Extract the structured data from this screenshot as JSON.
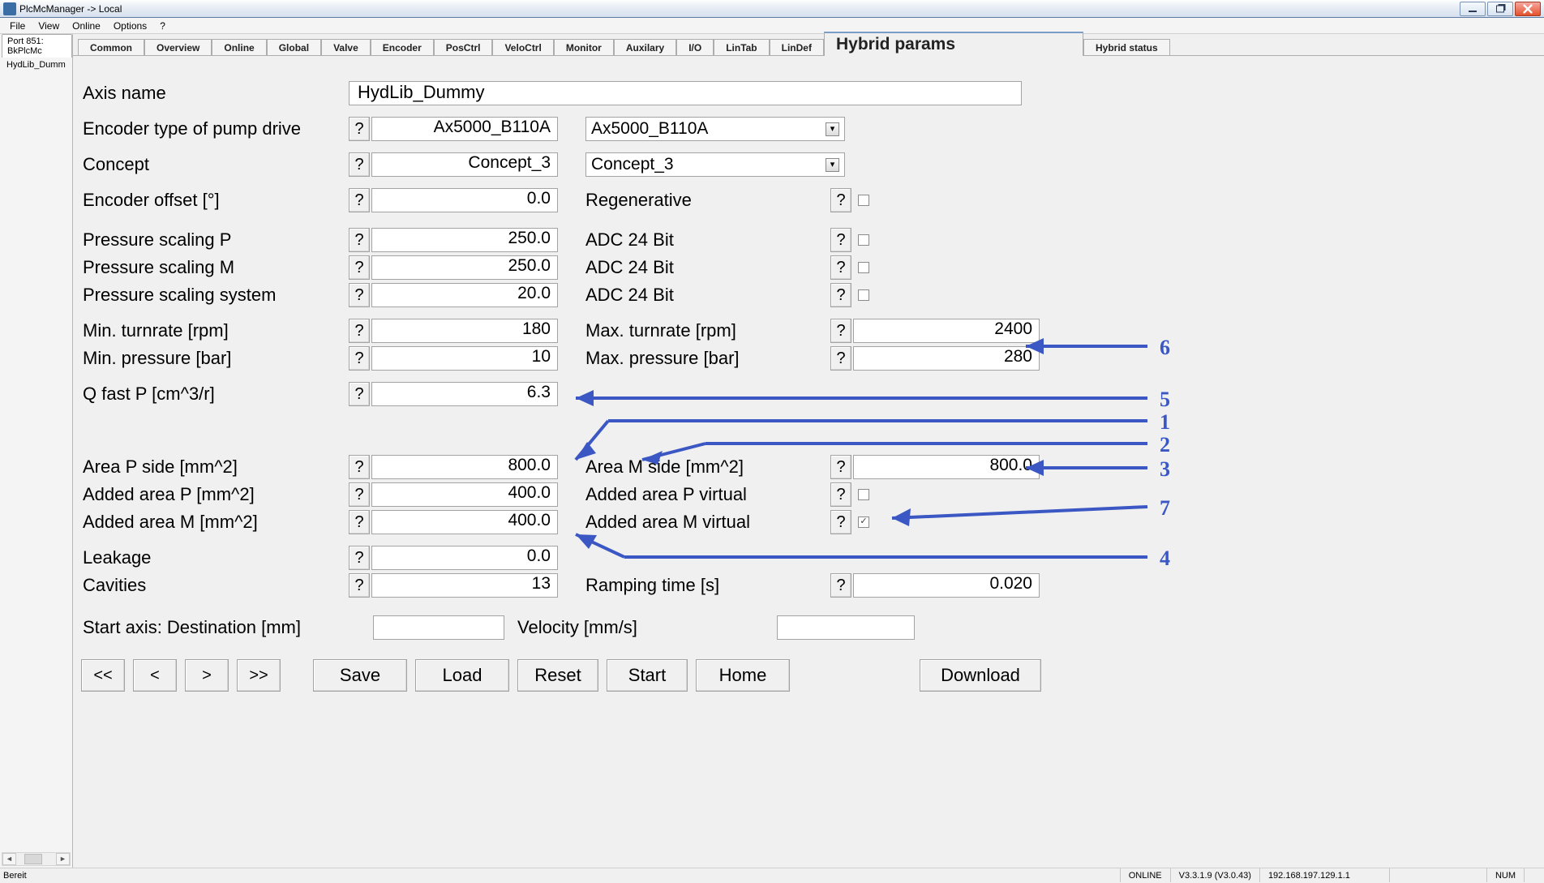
{
  "window": {
    "title": "PlcMcManager -> Local"
  },
  "menu": {
    "items": [
      "File",
      "View",
      "Online",
      "Options",
      "?"
    ]
  },
  "sidebar": {
    "tab": "Port 851: BkPlcMc",
    "item": "HydLib_Dumm"
  },
  "tabs": {
    "items": [
      "Common",
      "Overview",
      "Online",
      "Global",
      "Valve",
      "Encoder",
      "PosCtrl",
      "VeloCtrl",
      "Monitor",
      "Auxilary",
      "I/O",
      "LinTab",
      "LinDef",
      "Hybrid params",
      "Hybrid status"
    ],
    "selected": 13
  },
  "form": {
    "axis_name": {
      "label": "Axis name",
      "value": "HydLib_Dummy"
    },
    "encoder_type": {
      "label": "Encoder type of pump drive",
      "value": "Ax5000_B110A",
      "select": "Ax5000_B110A"
    },
    "concept": {
      "label": "Concept",
      "value": "Concept_3",
      "select": "Concept_3"
    },
    "encoder_offset": {
      "label": "Encoder offset [°]",
      "value": "0.0",
      "rlabel": "Regenerative"
    },
    "ps_p": {
      "label": "Pressure scaling P",
      "value": "250.0",
      "rlabel": "ADC 24 Bit"
    },
    "ps_m": {
      "label": "Pressure scaling M",
      "value": "250.0",
      "rlabel": "ADC 24 Bit"
    },
    "ps_sys": {
      "label": "Pressure scaling system",
      "value": "20.0",
      "rlabel": "ADC 24 Bit"
    },
    "min_turn": {
      "label": "Min. turnrate [rpm]",
      "value": "180"
    },
    "max_turn": {
      "label": "Max. turnrate [rpm]",
      "value": "2400"
    },
    "min_press": {
      "label": "Min. pressure [bar]",
      "value": "10"
    },
    "max_press": {
      "label": "Max. pressure [bar]",
      "value": "280"
    },
    "q_fast": {
      "label": "Q fast P [cm^3/r]",
      "value": "6.3"
    },
    "area_p": {
      "label": "Area P side [mm^2]",
      "value": "800.0"
    },
    "area_m": {
      "label": "Area M side [mm^2]",
      "value": "800.0"
    },
    "added_p": {
      "label": "Added area P [mm^2]",
      "value": "400.0",
      "rlabel": "Added area P virtual"
    },
    "added_m": {
      "label": "Added area M [mm^2]",
      "value": "400.0",
      "rlabel": "Added area M virtual"
    },
    "leakage": {
      "label": "Leakage",
      "value": "0.0"
    },
    "cavities": {
      "label": "Cavities",
      "value": "13"
    },
    "ramping": {
      "label": "Ramping time [s]",
      "value": "0.020"
    },
    "start_axis": {
      "label": "Start axis: Destination [mm]",
      "value": ""
    },
    "velocity": {
      "label": "Velocity [mm/s]",
      "value": ""
    }
  },
  "buttons": {
    "nav": [
      "<<",
      "<",
      ">",
      ">>"
    ],
    "main": [
      "Save",
      "Load",
      "Reset",
      "Start",
      "Home"
    ],
    "download": "Download"
  },
  "annotations": [
    "1",
    "2",
    "3",
    "4",
    "5",
    "6",
    "7"
  ],
  "status": {
    "ready": "Bereit",
    "online": "ONLINE",
    "ver": "V3.3.1.9 (V3.0.43)",
    "ip": "192.168.197.129.1.1",
    "num": "NUM"
  },
  "help": "?"
}
